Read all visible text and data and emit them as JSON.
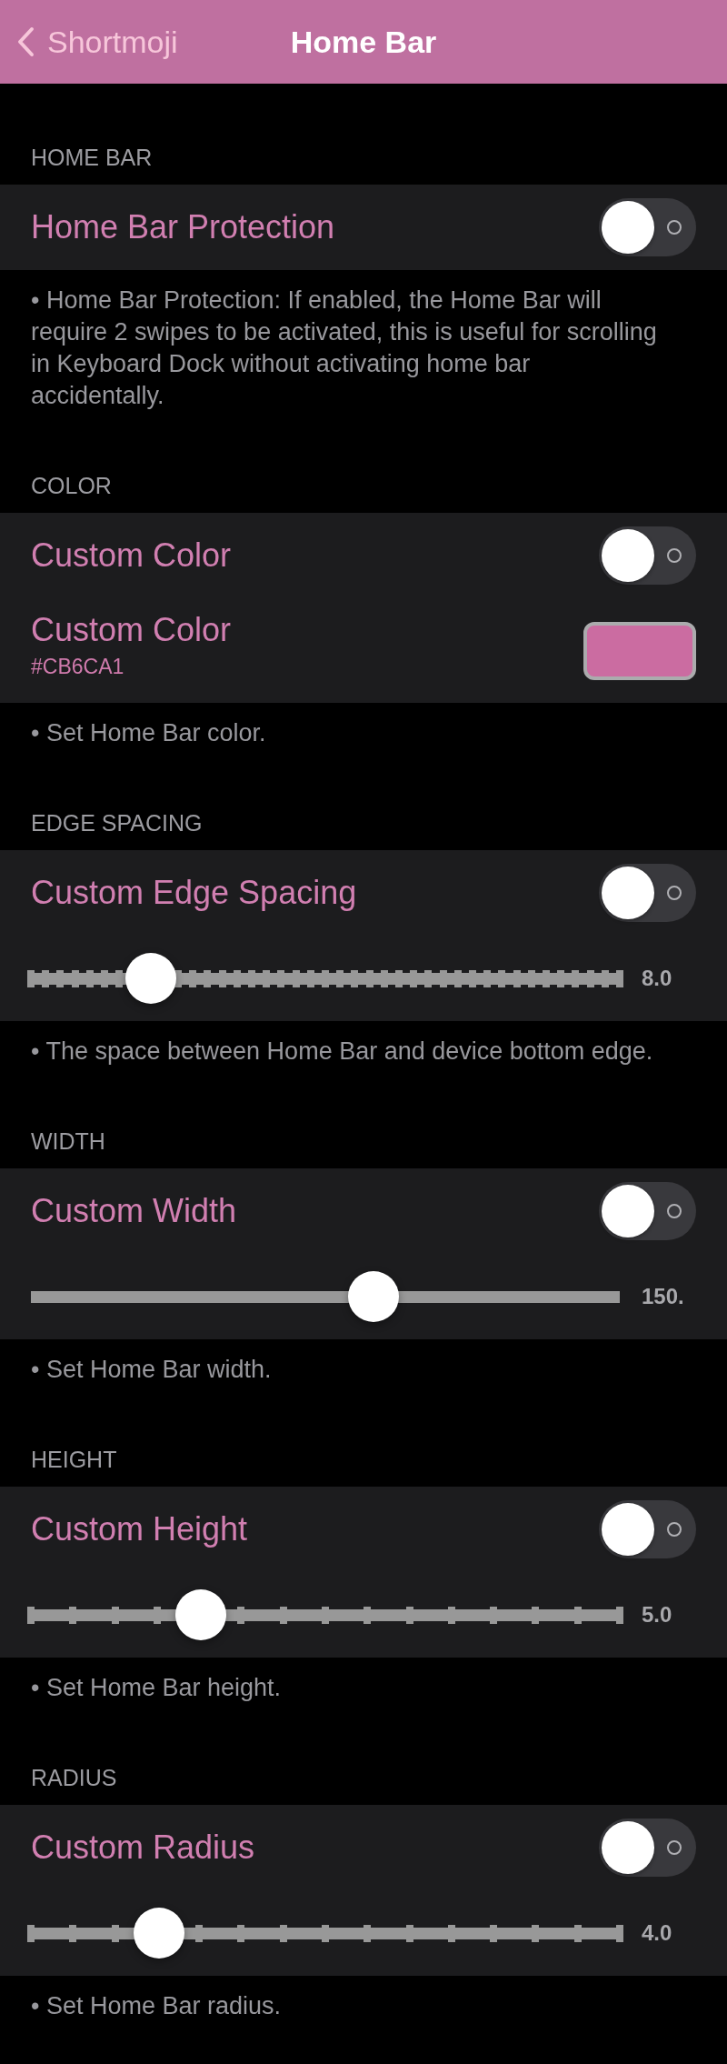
{
  "nav": {
    "back_label": "Shortmoji",
    "title": "Home Bar"
  },
  "sections": [
    {
      "header": "HOME BAR",
      "rows": [
        {
          "kind": "toggle",
          "label": "Home Bar Protection",
          "on": false
        }
      ],
      "footer": "• Home Bar Protection: If enabled, the Home Bar will require 2 swipes to be activated, this is useful for scrolling in Keyboard Dock without activating home bar accidentally."
    },
    {
      "header": "COLOR",
      "rows": [
        {
          "kind": "toggle",
          "label": "Custom Color",
          "on": false
        },
        {
          "kind": "color",
          "label": "Custom Color",
          "value": "#CB6CA1",
          "color": "#cb6ca1"
        }
      ],
      "footer": "• Set Home Bar color."
    },
    {
      "header": "EDGE SPACING",
      "rows": [
        {
          "kind": "toggle",
          "label": "Custom Edge Spacing",
          "on": false
        },
        {
          "kind": "fine-step-slider",
          "level": 0.204,
          "reading": "8.0"
        }
      ],
      "footer": "• The space between Home Bar and device bottom edge."
    },
    {
      "header": "WIDTH",
      "rows": [
        {
          "kind": "toggle",
          "label": "Custom Width",
          "on": false
        },
        {
          "kind": "slider",
          "level": 0.582,
          "reading": "150."
        }
      ],
      "footer": "• Set Home Bar width."
    },
    {
      "header": "HEIGHT",
      "rows": [
        {
          "kind": "toggle",
          "label": "Custom Height",
          "on": false
        },
        {
          "kind": "step-slider",
          "level": 0.289,
          "reading": "5.0"
        }
      ],
      "footer": "• Set Home Bar height."
    },
    {
      "header": "RADIUS",
      "rows": [
        {
          "kind": "toggle",
          "label": "Custom Radius",
          "on": false
        },
        {
          "kind": "step-slider",
          "level": 0.218,
          "reading": "4.0"
        }
      ],
      "footer": "• Set Home Bar radius."
    }
  ]
}
